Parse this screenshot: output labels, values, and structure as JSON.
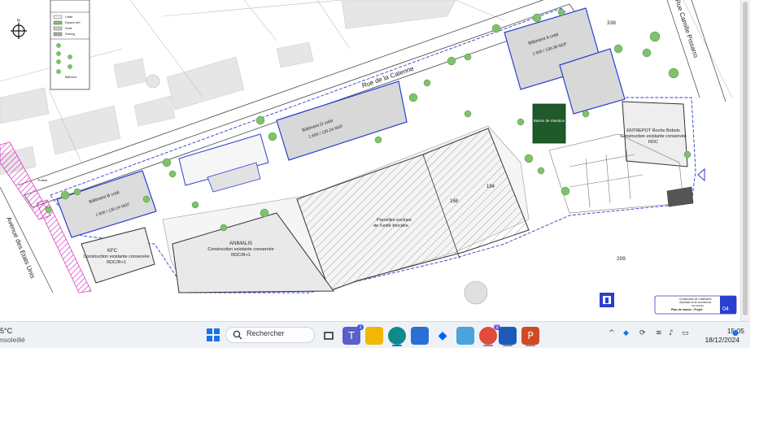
{
  "plan": {
    "street_rue_catenne": "Rue de la Catenne",
    "street_camille": "Rue Camille Pissarro",
    "street_avenue": "Avenue des Etats Unis",
    "kfc_title": "KFC",
    "kfc_sub": "Construction existante conservée",
    "kfc_level": "RDC/R+1",
    "animalis_title": "ANIMALIS",
    "animalis_sub": "Construction existante conservée",
    "animalis_level": "RDC/R+1",
    "parcel_label_1": "Parcelles exclues",
    "parcel_label_2": "de l'unité foncière",
    "parcel_num_1": "168",
    "parcel_num_2": "194",
    "parcel_num_3": "209",
    "parcel_num_4": "338",
    "entrepot_title": "ENTREPOT Roche Bobois",
    "entrepot_sub": "Construction existante conservée",
    "entrepot_level": "RDC",
    "batiment_b": "Bâtiment B créé",
    "batiment_b_ngf": "1 600 / 130.24 NGF",
    "batiment_c": "Bâtiment C créé",
    "batiment_c_ngf": "1 600 / 130.24 NGF",
    "batiment_d": "Bâtiment D créé",
    "batiment_d_ngf": "1 600 / 130.24 NGF",
    "batiment_a": "Bâtiment A créé",
    "batiment_a_ngf": "1 600 / 130.38 NGF",
    "green_box": "Bassin de rétention",
    "cartouche_title": "Plan de masse - Projet",
    "cartouche_num": "04",
    "cartouche_date": "02/12/2024",
    "cartouche_line1": "Construction de 3 bâtiments",
    "cartouche_line2": "d'activités et de commerces",
    "north_label": "N",
    "road_label": "Trottoir"
  },
  "legend": {
    "items": [
      "Limite",
      "Espace vert",
      "Voirie",
      "Parking",
      "Bâtiment"
    ]
  },
  "taskbar": {
    "weather_temp": "5°C",
    "weather_desc": "nsoleillé",
    "search_placeholder": "Rechercher",
    "clock_time": "15:05",
    "clock_date": "18/12/2024",
    "teams_badge": "1",
    "chrome_badge": "2"
  },
  "colors": {
    "accent_blue": "#2a3fd1",
    "green_tree": "#7fc26b",
    "magenta": "#d63cc4",
    "dark_green": "#1f5a2a",
    "taskbar_bg": "#eef2f7"
  }
}
